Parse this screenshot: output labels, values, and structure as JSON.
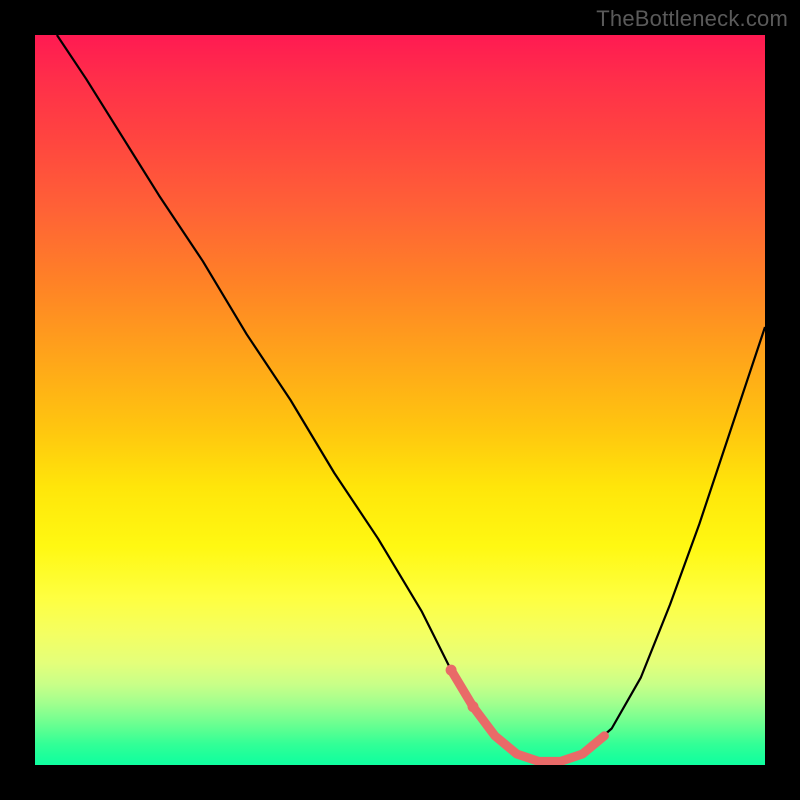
{
  "watermark": "TheBottleneck.com",
  "chart_data": {
    "type": "line",
    "title": "",
    "xlabel": "",
    "ylabel": "",
    "xlim": [
      0,
      100
    ],
    "ylim": [
      0,
      100
    ],
    "background_gradient": {
      "top": "#ff1a52",
      "middle": "#ffe60a",
      "bottom": "#0fffa0",
      "meaning": "top_red_high_bottleneck_bottom_green_low_bottleneck"
    },
    "series": [
      {
        "name": "bottleneck-curve",
        "color": "#000000",
        "x": [
          3,
          7,
          12,
          17,
          23,
          29,
          35,
          41,
          47,
          53,
          57,
          60,
          63,
          66,
          69,
          72,
          75,
          79,
          83,
          87,
          91,
          95,
          100
        ],
        "y": [
          100,
          94,
          86,
          78,
          69,
          59,
          50,
          40,
          31,
          21,
          13,
          8,
          4,
          1.5,
          0.5,
          0.5,
          1.5,
          5,
          12,
          22,
          33,
          45,
          60
        ]
      },
      {
        "name": "highlight-segment",
        "color": "#e96a68",
        "marker": "circle",
        "x": [
          57,
          60,
          63,
          66,
          69,
          72,
          75,
          78
        ],
        "y": [
          13,
          8,
          4,
          1.5,
          0.5,
          0.5,
          1.5,
          4
        ]
      }
    ],
    "annotations": []
  }
}
